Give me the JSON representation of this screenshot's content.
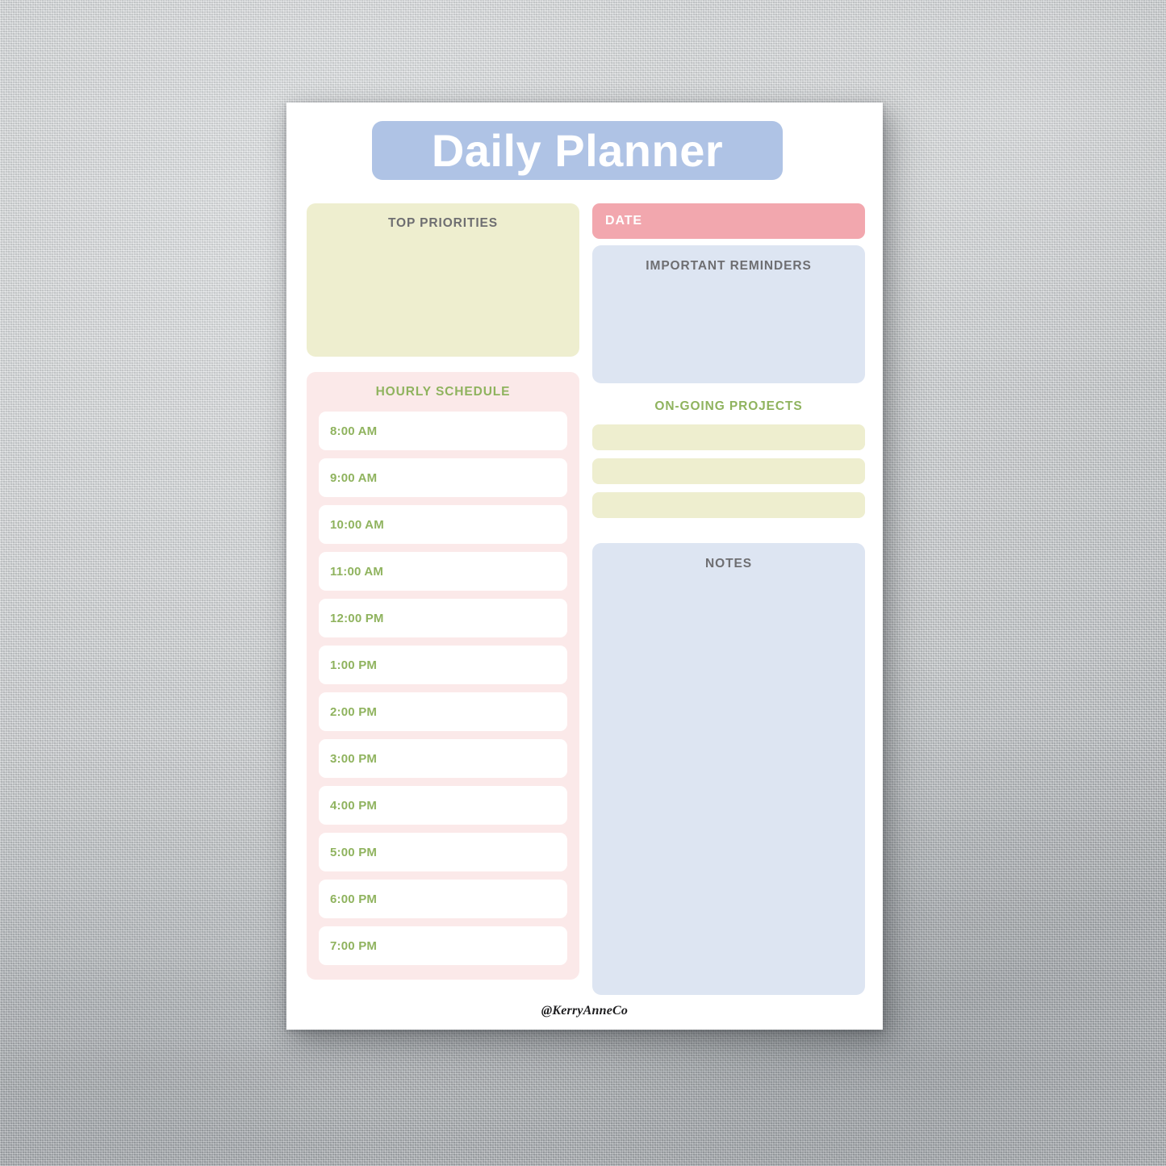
{
  "page": {
    "title": "Daily Planner",
    "footer_handle": "@KerryAnneCo"
  },
  "left_column": {
    "priorities": {
      "heading": "TOP PRIORITIES"
    },
    "schedule": {
      "heading": "HOURLY SCHEDULE",
      "slots": [
        "8:00 AM",
        "9:00 AM",
        "10:00 AM",
        "11:00 AM",
        "12:00 PM",
        "1:00 PM",
        "2:00 PM",
        "3:00 PM",
        "4:00 PM",
        "5:00 PM",
        "6:00 PM",
        "7:00 PM"
      ]
    }
  },
  "right_column": {
    "date": {
      "label": "DATE",
      "value": ""
    },
    "reminders": {
      "heading": "IMPORTANT REMINDERS"
    },
    "projects": {
      "heading": "ON-GOING PROJECTS",
      "rows": [
        "",
        "",
        ""
      ]
    },
    "notes": {
      "heading": "NOTES"
    }
  },
  "colors": {
    "title_blue": "#AFC3E5",
    "pale_yellow": "#EEEECF",
    "pale_pink": "#FBE9E9",
    "salmon": "#F2A7AE",
    "light_blue": "#DDE5F2",
    "green_text": "#8FB35E",
    "grey_text": "#6E6E71",
    "paper_white": "#FFFFFF"
  }
}
